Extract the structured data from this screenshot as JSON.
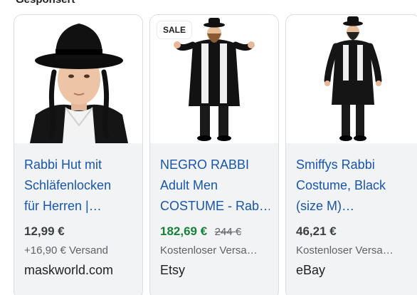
{
  "header": {
    "title": "Gesponsert"
  },
  "cards": [
    {
      "badge": "",
      "title_lines": [
        "Rabbi Hut mit",
        "Schläfenlocken",
        "für Herren |…"
      ],
      "price": "12,99 €",
      "old_price": "",
      "shipping": "+16,90 € Versand",
      "store": "maskworld.com",
      "image_icon": "rabbi-hat-with-sidelocks-photo"
    },
    {
      "badge": "SALE",
      "title_lines": [
        "NEGRO RABBI",
        "Adult Men",
        "COSTUME - Rab…"
      ],
      "price": "182,69 €",
      "old_price": "244 €",
      "shipping": "Kostenloser Versa…",
      "store": "Etsy",
      "image_icon": "rabbi-costume-photo"
    },
    {
      "badge": "",
      "title_lines": [
        "Smiffys Rabbi",
        "Costume, Black",
        "(size M)…"
      ],
      "price": "46,21 €",
      "old_price": "",
      "shipping": "Kostenloser Versa…",
      "store": "eBay",
      "image_icon": "rabbi-costume-photo"
    }
  ],
  "colors": {
    "link": "#1a56a8",
    "sale_price": "#188038",
    "card_bg": "#f1f3f4"
  }
}
